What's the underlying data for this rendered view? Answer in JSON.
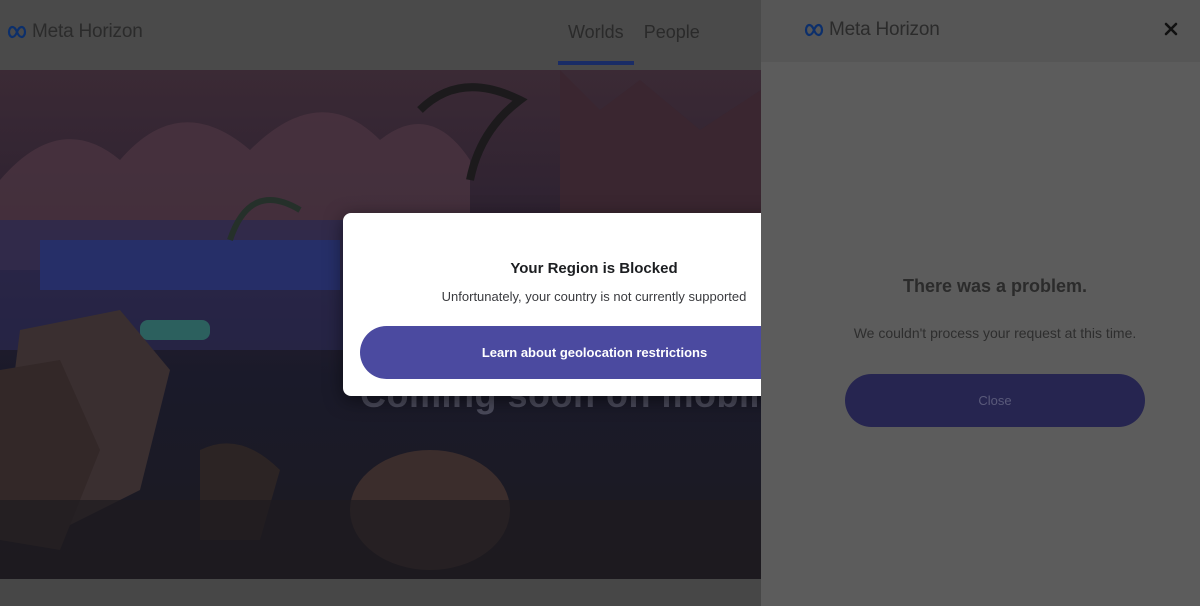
{
  "header": {
    "logo_text": "Meta Horizon",
    "nav": [
      {
        "label": "Worlds"
      },
      {
        "label": "People"
      }
    ]
  },
  "hero": {
    "headline": "Coming soon on mobile and"
  },
  "modal": {
    "title": "Your Region is Blocked",
    "subtitle": "Unfortunately, your country is not currently supported",
    "button_label": "Learn about geolocation restrictions"
  },
  "panel": {
    "logo_text": "Meta Horizon",
    "title": "There was a problem.",
    "message": "We couldn't process your request at this time.",
    "button_label": "Close"
  },
  "colors": {
    "modal_button": "#4b4aa0",
    "panel_button": "#262550",
    "focus_ring": "#1f4fd1",
    "meta_blue": "#0866ff"
  },
  "icons": {
    "logo": "meta-infinity-icon",
    "close": "close-icon"
  }
}
